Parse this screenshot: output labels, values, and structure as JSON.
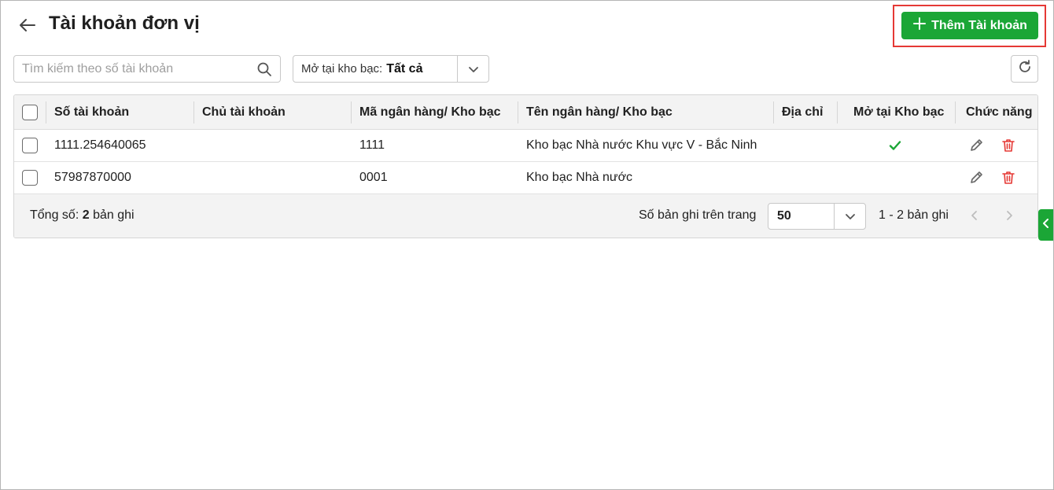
{
  "header": {
    "title": "Tài khoản đơn vị",
    "back_icon": "arrow-left-icon",
    "add_button_label": "Thêm Tài khoản",
    "add_icon": "plus-icon"
  },
  "search": {
    "placeholder": "Tìm kiếm theo số tài khoản",
    "value": "",
    "icon": "search-icon"
  },
  "filter": {
    "label": "Mở tại kho bạc:",
    "selected": "Tất cả",
    "icon": "chevron-down-icon"
  },
  "toolbar": {
    "refresh_icon": "refresh-icon"
  },
  "table": {
    "columns": [
      "Số tài khoản",
      "Chủ tài khoản",
      "Mã ngân hàng/ Kho bạc",
      "Tên ngân hàng/ Kho bạc",
      "Địa chỉ",
      "Mở tại Kho bạc",
      "Chức năng"
    ],
    "rows": [
      {
        "account_no": "1111.254640065",
        "owner": "",
        "bank_code": "1111",
        "bank_name": "Kho bạc Nhà nước Khu vực V - Bắc Ninh",
        "address": "",
        "at_treasury": true
      },
      {
        "account_no": "57987870000",
        "owner": "",
        "bank_code": "0001",
        "bank_name": "Kho bạc Nhà nước",
        "address": "",
        "at_treasury": false
      }
    ]
  },
  "footer": {
    "total_label": "Tổng số:",
    "total_count": "2",
    "total_unit": "bản ghi",
    "page_size_label": "Số bản ghi trên trang",
    "page_size_value": "50",
    "range_text": "1 - 2 bản ghi"
  },
  "colors": {
    "primary_green": "#1ba636",
    "delete_red": "#e53935",
    "highlight_red": "#e53935"
  }
}
